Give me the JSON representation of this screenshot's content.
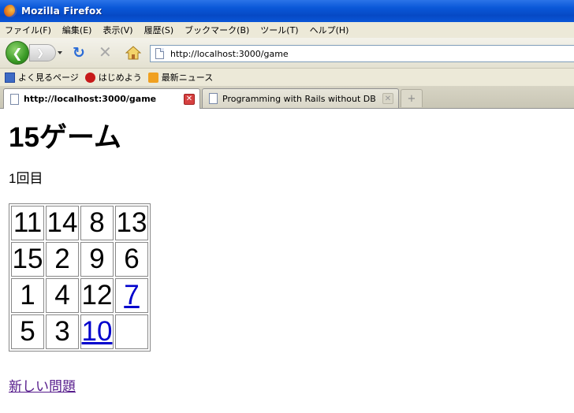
{
  "window": {
    "title": "Mozilla Firefox"
  },
  "menubar": {
    "items": [
      "ファイル(F)",
      "編集(E)",
      "表示(V)",
      "履歴(S)",
      "ブックマーク(B)",
      "ツール(T)",
      "ヘルプ(H)"
    ]
  },
  "navbar": {
    "url": "http://localhost:3000/game",
    "back_icon": "back-arrow-icon",
    "forward_icon": "forward-arrow-icon",
    "reload_icon": "reload-icon",
    "stop_icon": "stop-icon",
    "home_icon": "home-icon"
  },
  "bookmarks": {
    "items": [
      "よく見るページ",
      "はじめよう",
      "最新ニュース"
    ]
  },
  "tabs": {
    "items": [
      "http://localhost:3000/game",
      "Programming with Rails without DB"
    ],
    "active_index": 0
  },
  "page": {
    "title": "15ゲーム",
    "round": "1回目",
    "board": [
      [
        "11",
        "14",
        "8",
        "13"
      ],
      [
        "15",
        "2",
        "9",
        "6"
      ],
      [
        "1",
        "4",
        "12",
        "7"
      ],
      [
        "5",
        "3",
        "10",
        ""
      ]
    ],
    "movable": [
      "7",
      "10"
    ],
    "new_problem_link": "新しい問題"
  },
  "colors": {
    "titlebar": "#0a58d8",
    "link": "#0000cc",
    "visited_link": "#551a8b"
  }
}
